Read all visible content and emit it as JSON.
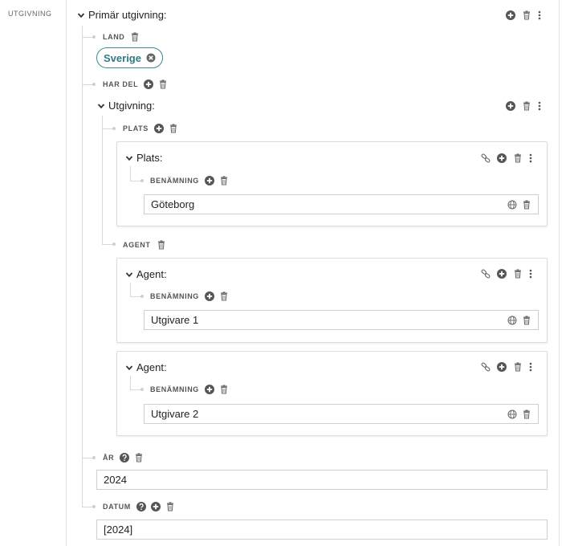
{
  "sidebar": {
    "label": "UTGIVNING"
  },
  "primary": {
    "title": "Primär utgivning:",
    "land": {
      "label": "LAND",
      "value": "Sverige"
    },
    "har_del": {
      "label": "HAR DEL",
      "utgivning": {
        "title": "Utgivning:",
        "plats": {
          "label": "PLATS",
          "card": {
            "title": "Plats:",
            "benamning_label": "BENÄMNING",
            "value": "Göteborg"
          }
        },
        "agent": {
          "label": "AGENT",
          "cards": [
            {
              "title": "Agent:",
              "benamning_label": "BENÄMNING",
              "value": "Utgivare 1"
            },
            {
              "title": "Agent:",
              "benamning_label": "BENÄMNING",
              "value": "Utgivare 2"
            }
          ]
        }
      }
    },
    "ar": {
      "label": "ÅR",
      "value": "2024"
    },
    "datum": {
      "label": "DATUM",
      "value": "[2024]"
    }
  },
  "colors": {
    "accent": "#3a8a96",
    "icon": "#555555",
    "border": "#cfcfcf"
  }
}
